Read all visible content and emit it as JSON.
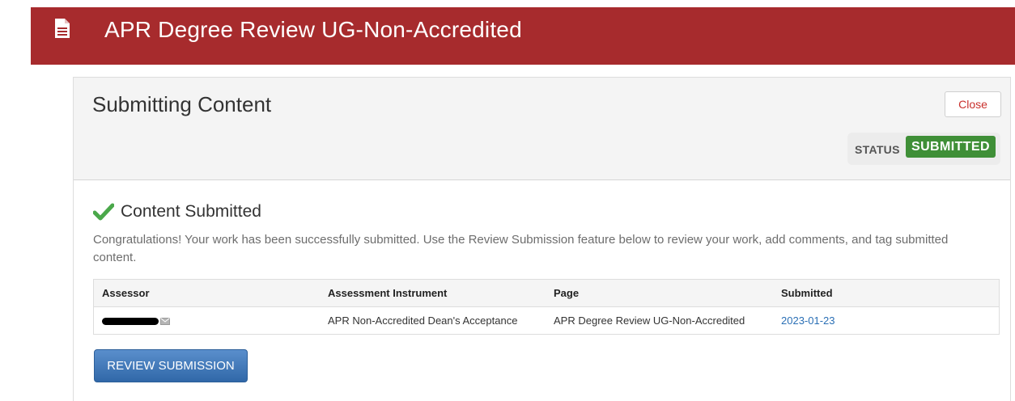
{
  "header": {
    "title": "APR Degree Review UG-Non-Accredited",
    "icon": "document-icon",
    "background_color": "#a72b2d"
  },
  "panel": {
    "title": "Submitting Content",
    "close_label": "Close",
    "status_label": "STATUS",
    "status_value": "SUBMITTED",
    "status_color": "#3f8f37"
  },
  "confirmation": {
    "icon": "checkmark-icon",
    "title": "Content Submitted",
    "message": "Congratulations! Your work has been successfully submitted. Use the Review Submission feature below to review your work, add comments, and tag submitted content."
  },
  "table": {
    "headers": [
      "Assessor",
      "Assessment Instrument",
      "Page",
      "Submitted"
    ],
    "rows": [
      {
        "assessor_icon": "email-icon",
        "instrument": "APR Non-Accredited Dean's Acceptance",
        "page": "APR Degree Review UG-Non-Accredited",
        "submitted": "2023-01-23"
      }
    ]
  },
  "actions": {
    "review_label": "REVIEW SUBMISSION"
  }
}
